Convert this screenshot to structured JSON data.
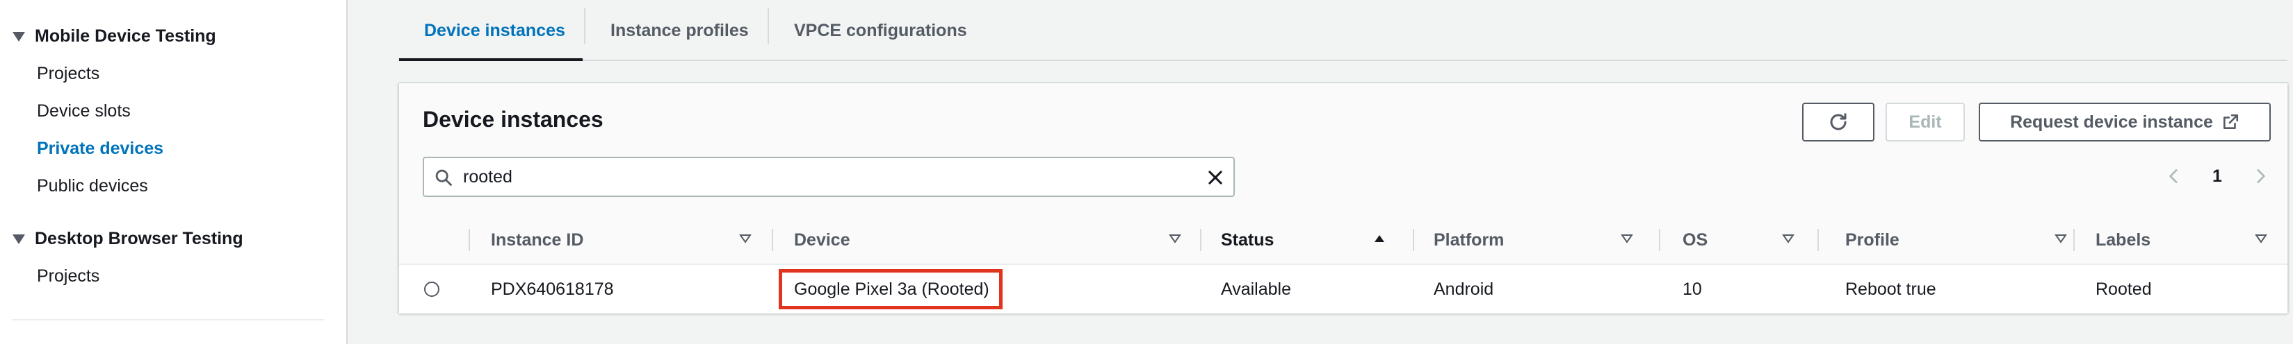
{
  "sidebar": {
    "sections": [
      {
        "label": "Mobile Device Testing",
        "items": [
          "Projects",
          "Device slots",
          "Private devices",
          "Public devices"
        ]
      },
      {
        "label": "Desktop Browser Testing",
        "items": [
          "Projects"
        ]
      }
    ],
    "active_item": "Private devices"
  },
  "tabs": [
    "Device instances",
    "Instance profiles",
    "VPCE configurations"
  ],
  "active_tab": "Device instances",
  "panel": {
    "title": "Device instances",
    "buttons": {
      "refresh_icon": "refresh-icon",
      "edit": "Edit",
      "request": "Request device instance",
      "request_icon": "external-link-icon"
    },
    "search": {
      "value": "rooted"
    },
    "pagination": {
      "current_page": "1"
    }
  },
  "table": {
    "columns": [
      "Instance ID",
      "Device",
      "Status",
      "Platform",
      "OS",
      "Profile",
      "Labels"
    ],
    "sorted_column": "Status",
    "rows": [
      {
        "instance_id": "PDX640618178",
        "device": "Google Pixel 3a (Rooted)",
        "status": "Available",
        "platform": "Android",
        "os": "10",
        "profile": "Reboot true",
        "labels": "Rooted"
      }
    ]
  },
  "colors": {
    "accent": "#0073bb",
    "highlight": "#e0341f",
    "text": "#16191f",
    "muted": "#545b64"
  }
}
